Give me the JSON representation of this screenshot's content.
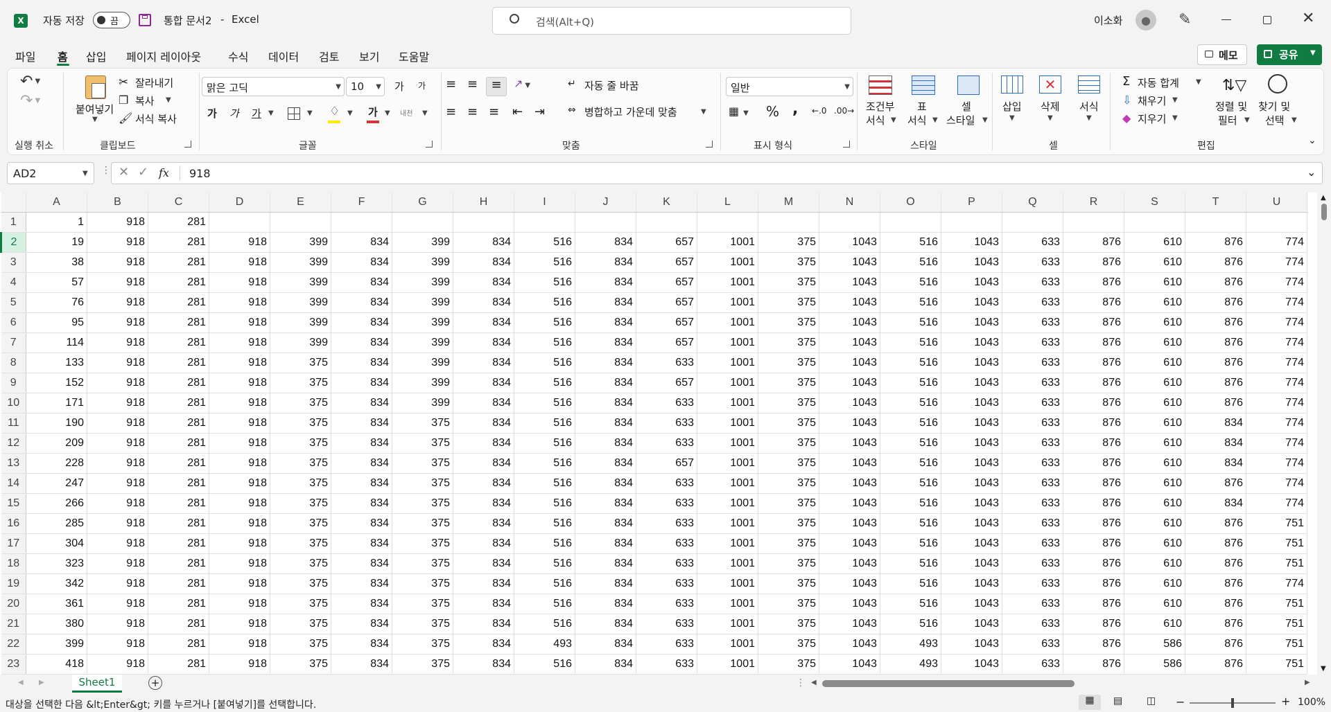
{
  "titlebar": {
    "autosave_label": "자동 저장",
    "autosave_state": "끔",
    "doc_title": "통합 문서2",
    "title_sep": "-",
    "app_name": "Excel",
    "search_placeholder": "검색(Alt+Q)",
    "user_name": "이소화"
  },
  "menu": {
    "tabs": [
      "파일",
      "홈",
      "삽입",
      "페이지 레이아웃",
      "수식",
      "데이터",
      "검토",
      "보기",
      "도움말"
    ],
    "active": "홈",
    "memo_label": "메모",
    "share_label": "공유"
  },
  "ribbon": {
    "undo_group": {
      "label": "실행 취소"
    },
    "clipboard": {
      "label": "클립보드",
      "paste": "붙여넣기",
      "cut": "잘라내기",
      "copy": "복사",
      "format_painter": "서식 복사"
    },
    "font": {
      "label": "글꼴",
      "font_name": "맑은 고딕",
      "font_size": "10",
      "bold_glyph": "가",
      "italic_glyph": "가",
      "underline_glyph": "가",
      "grow_glyph": "가",
      "shrink_glyph": "가",
      "color_glyph": "가",
      "phonetic_glyph": "내천"
    },
    "alignment": {
      "label": "맞춤",
      "wrap_text": "자동 줄 바꿈",
      "merge_center": "병합하고 가운데 맞춤"
    },
    "number": {
      "label": "표시 형식",
      "format": "일반",
      "percent": "%",
      "comma": ","
    },
    "styles": {
      "label": "스타일",
      "conditional_line1": "조건부",
      "conditional_line2": "서식",
      "table_line1": "표",
      "table_line2": "서식",
      "cell_style_line1": "셀",
      "cell_style_line2": "스타일"
    },
    "cells": {
      "label": "셀",
      "insert": "삽입",
      "delete": "삭제",
      "format": "서식"
    },
    "editing": {
      "label": "편집",
      "autosum": "자동 합계",
      "fill": "채우기",
      "clear": "지우기",
      "sort_line1": "정렬 및",
      "sort_line2": "필터",
      "find_line1": "찾기 및",
      "find_line2": "선택"
    }
  },
  "formula_bar": {
    "name_box": "AD2",
    "fx": "fx",
    "value": "918"
  },
  "sheet": {
    "columns": [
      "A",
      "B",
      "C",
      "D",
      "E",
      "F",
      "G",
      "H",
      "I",
      "J",
      "K",
      "L",
      "M",
      "N",
      "O",
      "P",
      "Q",
      "R",
      "S",
      "T",
      "U"
    ],
    "rows": [
      {
        "n": "1",
        "cells": [
          "1",
          "918",
          "281",
          "",
          "",
          "",
          "",
          "",
          "",
          "",
          "",
          "",
          "",
          "",
          "",
          "",
          "",
          "",
          "",
          "",
          ""
        ]
      },
      {
        "n": "2",
        "cells": [
          "19",
          "918",
          "281",
          "918",
          "399",
          "834",
          "399",
          "834",
          "516",
          "834",
          "657",
          "1001",
          "375",
          "1043",
          "516",
          "1043",
          "633",
          "876",
          "610",
          "876",
          "774"
        ]
      },
      {
        "n": "3",
        "cells": [
          "38",
          "918",
          "281",
          "918",
          "399",
          "834",
          "399",
          "834",
          "516",
          "834",
          "657",
          "1001",
          "375",
          "1043",
          "516",
          "1043",
          "633",
          "876",
          "610",
          "876",
          "774"
        ]
      },
      {
        "n": "4",
        "cells": [
          "57",
          "918",
          "281",
          "918",
          "399",
          "834",
          "399",
          "834",
          "516",
          "834",
          "657",
          "1001",
          "375",
          "1043",
          "516",
          "1043",
          "633",
          "876",
          "610",
          "876",
          "774"
        ]
      },
      {
        "n": "5",
        "cells": [
          "76",
          "918",
          "281",
          "918",
          "399",
          "834",
          "399",
          "834",
          "516",
          "834",
          "657",
          "1001",
          "375",
          "1043",
          "516",
          "1043",
          "633",
          "876",
          "610",
          "876",
          "774"
        ]
      },
      {
        "n": "6",
        "cells": [
          "95",
          "918",
          "281",
          "918",
          "399",
          "834",
          "399",
          "834",
          "516",
          "834",
          "657",
          "1001",
          "375",
          "1043",
          "516",
          "1043",
          "633",
          "876",
          "610",
          "876",
          "774"
        ]
      },
      {
        "n": "7",
        "cells": [
          "114",
          "918",
          "281",
          "918",
          "399",
          "834",
          "399",
          "834",
          "516",
          "834",
          "657",
          "1001",
          "375",
          "1043",
          "516",
          "1043",
          "633",
          "876",
          "610",
          "876",
          "774"
        ]
      },
      {
        "n": "8",
        "cells": [
          "133",
          "918",
          "281",
          "918",
          "375",
          "834",
          "399",
          "834",
          "516",
          "834",
          "633",
          "1001",
          "375",
          "1043",
          "516",
          "1043",
          "633",
          "876",
          "610",
          "876",
          "774"
        ]
      },
      {
        "n": "9",
        "cells": [
          "152",
          "918",
          "281",
          "918",
          "375",
          "834",
          "399",
          "834",
          "516",
          "834",
          "657",
          "1001",
          "375",
          "1043",
          "516",
          "1043",
          "633",
          "876",
          "610",
          "876",
          "774"
        ]
      },
      {
        "n": "10",
        "cells": [
          "171",
          "918",
          "281",
          "918",
          "375",
          "834",
          "399",
          "834",
          "516",
          "834",
          "633",
          "1001",
          "375",
          "1043",
          "516",
          "1043",
          "633",
          "876",
          "610",
          "876",
          "774"
        ]
      },
      {
        "n": "11",
        "cells": [
          "190",
          "918",
          "281",
          "918",
          "375",
          "834",
          "375",
          "834",
          "516",
          "834",
          "633",
          "1001",
          "375",
          "1043",
          "516",
          "1043",
          "633",
          "876",
          "610",
          "834",
          "774"
        ]
      },
      {
        "n": "12",
        "cells": [
          "209",
          "918",
          "281",
          "918",
          "375",
          "834",
          "375",
          "834",
          "516",
          "834",
          "633",
          "1001",
          "375",
          "1043",
          "516",
          "1043",
          "633",
          "876",
          "610",
          "834",
          "774"
        ]
      },
      {
        "n": "13",
        "cells": [
          "228",
          "918",
          "281",
          "918",
          "375",
          "834",
          "375",
          "834",
          "516",
          "834",
          "657",
          "1001",
          "375",
          "1043",
          "516",
          "1043",
          "633",
          "876",
          "610",
          "834",
          "774"
        ]
      },
      {
        "n": "14",
        "cells": [
          "247",
          "918",
          "281",
          "918",
          "375",
          "834",
          "375",
          "834",
          "516",
          "834",
          "633",
          "1001",
          "375",
          "1043",
          "516",
          "1043",
          "633",
          "876",
          "610",
          "876",
          "774"
        ]
      },
      {
        "n": "15",
        "cells": [
          "266",
          "918",
          "281",
          "918",
          "375",
          "834",
          "375",
          "834",
          "516",
          "834",
          "633",
          "1001",
          "375",
          "1043",
          "516",
          "1043",
          "633",
          "876",
          "610",
          "834",
          "774"
        ]
      },
      {
        "n": "16",
        "cells": [
          "285",
          "918",
          "281",
          "918",
          "375",
          "834",
          "375",
          "834",
          "516",
          "834",
          "633",
          "1001",
          "375",
          "1043",
          "516",
          "1043",
          "633",
          "876",
          "610",
          "876",
          "751"
        ]
      },
      {
        "n": "17",
        "cells": [
          "304",
          "918",
          "281",
          "918",
          "375",
          "834",
          "375",
          "834",
          "516",
          "834",
          "633",
          "1001",
          "375",
          "1043",
          "516",
          "1043",
          "633",
          "876",
          "610",
          "876",
          "751"
        ]
      },
      {
        "n": "18",
        "cells": [
          "323",
          "918",
          "281",
          "918",
          "375",
          "834",
          "375",
          "834",
          "516",
          "834",
          "633",
          "1001",
          "375",
          "1043",
          "516",
          "1043",
          "633",
          "876",
          "610",
          "876",
          "751"
        ]
      },
      {
        "n": "19",
        "cells": [
          "342",
          "918",
          "281",
          "918",
          "375",
          "834",
          "375",
          "834",
          "516",
          "834",
          "633",
          "1001",
          "375",
          "1043",
          "516",
          "1043",
          "633",
          "876",
          "610",
          "876",
          "774"
        ]
      },
      {
        "n": "20",
        "cells": [
          "361",
          "918",
          "281",
          "918",
          "375",
          "834",
          "375",
          "834",
          "516",
          "834",
          "633",
          "1001",
          "375",
          "1043",
          "516",
          "1043",
          "633",
          "876",
          "610",
          "876",
          "751"
        ]
      },
      {
        "n": "21",
        "cells": [
          "380",
          "918",
          "281",
          "918",
          "375",
          "834",
          "375",
          "834",
          "516",
          "834",
          "633",
          "1001",
          "375",
          "1043",
          "516",
          "1043",
          "633",
          "876",
          "610",
          "876",
          "751"
        ]
      },
      {
        "n": "22",
        "cells": [
          "399",
          "918",
          "281",
          "918",
          "375",
          "834",
          "375",
          "834",
          "493",
          "834",
          "633",
          "1001",
          "375",
          "1043",
          "493",
          "1043",
          "633",
          "876",
          "586",
          "876",
          "751"
        ]
      },
      {
        "n": "23",
        "cells": [
          "418",
          "918",
          "281",
          "918",
          "375",
          "834",
          "375",
          "834",
          "516",
          "834",
          "633",
          "1001",
          "375",
          "1043",
          "493",
          "1043",
          "633",
          "876",
          "586",
          "876",
          "751"
        ]
      }
    ]
  },
  "tabs": {
    "sheet_name": "Sheet1",
    "add_glyph": "+"
  },
  "status": {
    "message": "대상을 선택한 다음 &lt;Enter&gt; 키를 누르거나 [붙여넣기]를 선택합니다.",
    "zoom": "100%",
    "zoom_level_percent": 100
  },
  "colors": {
    "brand": "#107c41",
    "accent": "#107c41",
    "selected_header": "#d3f0e0",
    "font_color_bar": "#d13438",
    "fill_color_bar": "#ffeb00"
  },
  "icons": [
    "excel-logo-icon",
    "save-icon",
    "search-icon",
    "avatar-icon",
    "pen-icon",
    "minimize-icon",
    "restore-icon",
    "close-icon",
    "undo-icon",
    "redo-icon",
    "paste-icon",
    "cut-icon",
    "copy-icon",
    "format-painter-icon",
    "borders-icon",
    "fill-color-icon",
    "font-color-icon",
    "align-icon",
    "orientation-icon",
    "wrap-text-icon",
    "merge-icon",
    "currency-icon",
    "conditional-format-icon",
    "format-table-icon",
    "cell-styles-icon",
    "insert-cells-icon",
    "delete-cells-icon",
    "format-cells-icon",
    "autosum-icon",
    "fill-icon",
    "clear-icon",
    "sort-filter-icon",
    "find-icon",
    "cancel-icon",
    "enter-icon",
    "add-sheet-icon",
    "normal-view-icon",
    "page-layout-icon",
    "page-break-icon"
  ]
}
